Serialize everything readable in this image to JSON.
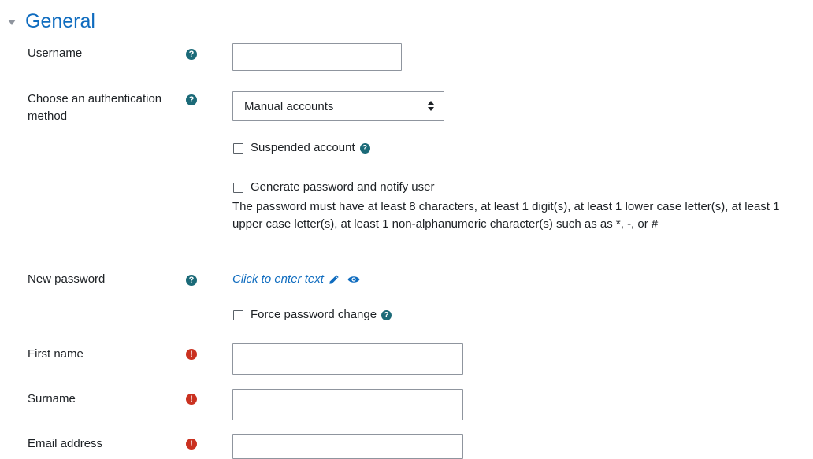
{
  "section": {
    "title": "General"
  },
  "fields": {
    "username": {
      "label": "Username",
      "value": ""
    },
    "auth": {
      "label_line1": "Choose an authentication",
      "label_line2": "method",
      "selected": "Manual accounts"
    },
    "suspended": {
      "label": "Suspended account"
    },
    "generate": {
      "label": "Generate password and notify user"
    },
    "password_note": "The password must have at least 8 characters, at least 1 digit(s), at least 1 lower case letter(s), at least 1 upper case letter(s), at least 1 non-alphanumeric character(s) such as as *, -, or #",
    "new_password": {
      "label": "New password",
      "link_text": "Click to enter text"
    },
    "force_change": {
      "label": "Force password change"
    },
    "first_name": {
      "label": "First name",
      "value": ""
    },
    "surname": {
      "label": "Surname",
      "value": ""
    },
    "email": {
      "label": "Email address",
      "value": ""
    }
  },
  "icons": {
    "help_glyph": "?",
    "required_glyph": "!"
  },
  "colors": {
    "link": "#0f6cbf",
    "help": "#1b6a78",
    "required": "#ca3120"
  }
}
